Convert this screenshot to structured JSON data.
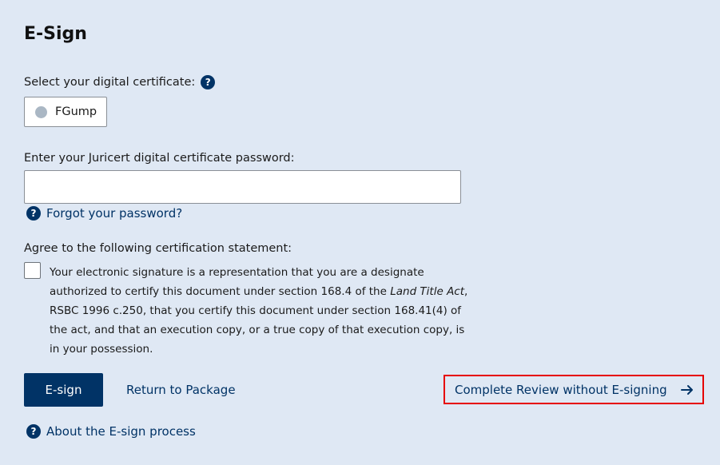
{
  "page": {
    "title": "E-Sign"
  },
  "certificate": {
    "label": "Select your digital certificate:",
    "help_icon": "question-circle-icon",
    "option": "FGump"
  },
  "password": {
    "label": "Enter your Juricert digital certificate password:",
    "value": "",
    "placeholder": "",
    "forgot_link": "Forgot your password?"
  },
  "statement": {
    "label": "Agree to the following certification statement:",
    "text_before": "Your electronic signature is a representation that you are a designate authorized to certify this document under section 168.4 of the ",
    "act_name": "Land Title Act",
    "text_after": ", RSBC 1996 c.250, that you certify this document under section 168.41(4) of the act, and that an execution copy, or a true copy of that execution copy, is in your possession."
  },
  "actions": {
    "esign_label": "E-sign",
    "return_label": "Return to Package",
    "complete_label": "Complete Review without E-signing",
    "about_link": "About the E-sign process"
  },
  "colors": {
    "background": "#dfe8f4",
    "primary": "#013366",
    "highlight": "#e60000"
  }
}
